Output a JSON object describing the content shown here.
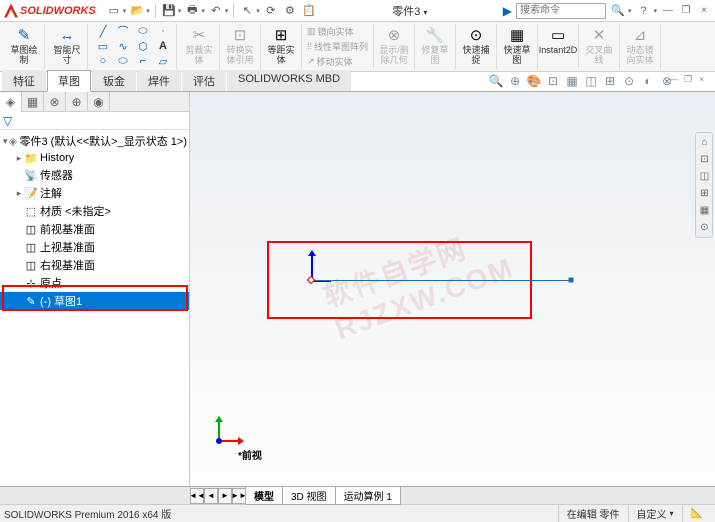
{
  "app": {
    "name": "SOLIDWORKS",
    "doc_title": "零件3"
  },
  "search": {
    "placeholder": "搜索命令",
    "glyph": "🔍",
    "help": "?"
  },
  "window_controls": {
    "min": "—",
    "restore": "❐",
    "close": "×"
  },
  "qat": {
    "new": "▭",
    "open": "📂",
    "save": "💾",
    "print": "🖶",
    "undo": "↶",
    "select": "↖",
    "rebuild": "⟳",
    "options": "⚙",
    "settings": "📋"
  },
  "ribbon": {
    "sketch": {
      "label": "草图绘\n制",
      "icon": "✎"
    },
    "smart_dim": {
      "label": "智能尺\n寸",
      "icon": "↔"
    },
    "tools": {
      "line": "╱",
      "rect": "▭",
      "circle": "○",
      "arc": "⌒",
      "spline": "∿",
      "ellipse": "⬭",
      "slot": "⬭",
      "poly": "⬡",
      "fillet": "⌐",
      "point": "·",
      "text": "A",
      "plane": "▱"
    },
    "groups": [
      {
        "label": "剪裁实\n体",
        "icon": "✂",
        "disabled": true
      },
      {
        "label": "转换实\n体引用",
        "icon": "⊡",
        "disabled": true
      },
      {
        "label": "等距实\n体",
        "icon": "⊞",
        "disabled": false
      },
      {
        "label": "镜向实体",
        "icon": "▥",
        "disabled": true,
        "small": true
      },
      {
        "label": "线性草图阵列",
        "icon": "⁞⁞",
        "disabled": true,
        "small": true
      },
      {
        "label": "移动实体",
        "icon": "↗",
        "disabled": true,
        "small": true
      },
      {
        "label": "显示/删\n除几何",
        "icon": "⊗",
        "disabled": true
      },
      {
        "label": "修复草\n图",
        "icon": "🔧",
        "disabled": true
      },
      {
        "label": "快速捕\n捉",
        "icon": "⊙",
        "disabled": false
      },
      {
        "label": "快速草\n图",
        "icon": "▦",
        "disabled": false
      },
      {
        "label": "Instant2D",
        "icon": "▭",
        "disabled": false
      },
      {
        "label": "交叉曲\n线",
        "icon": "✕",
        "disabled": true
      },
      {
        "label": "动态镜\n向实体",
        "icon": "⊿",
        "disabled": true
      }
    ]
  },
  "tabs": [
    "特征",
    "草图",
    "钣金",
    "焊件",
    "评估",
    "SOLIDWORKS MBD"
  ],
  "active_tab": 1,
  "view_toolbar": [
    "🔍",
    "⊕",
    "🎨",
    "⊡",
    "▦",
    "◫",
    "⊞",
    "⊙",
    "◐",
    "⊗"
  ],
  "sidebar_tabs": [
    "◈",
    "▦",
    "⊗",
    "⊕",
    "◉"
  ],
  "tree": {
    "root": "零件3 (默认<<默认>_显示状态 1>)",
    "nodes": [
      {
        "icon": "📁",
        "label": "History",
        "indent": 1,
        "toggle": "▸"
      },
      {
        "icon": "📡",
        "label": "传感器",
        "indent": 1,
        "toggle": ""
      },
      {
        "icon": "📝",
        "label": "注解",
        "indent": 1,
        "toggle": "▸"
      },
      {
        "icon": "⬚",
        "label": "材质 <未指定>",
        "indent": 1,
        "toggle": ""
      },
      {
        "icon": "◫",
        "label": "前视基准面",
        "indent": 1,
        "toggle": ""
      },
      {
        "icon": "◫",
        "label": "上视基准面",
        "indent": 1,
        "toggle": ""
      },
      {
        "icon": "◫",
        "label": "右视基准面",
        "indent": 1,
        "toggle": ""
      },
      {
        "icon": "⊹",
        "label": "原点",
        "indent": 1,
        "toggle": ""
      },
      {
        "icon": "✎",
        "label": "(-) 草图1",
        "indent": 1,
        "toggle": "",
        "selected": true
      }
    ]
  },
  "viewport": {
    "view_name": "*前视",
    "watermark": "软件自学网\nRJZXW.COM"
  },
  "bottom_tabs": [
    "模型",
    "3D 视图",
    "运动算例 1"
  ],
  "status": {
    "left": "SOLIDWORKS Premium 2016 x64 版",
    "mode": "在编辑 零件",
    "custom": "自定义"
  },
  "right_tools": [
    "⌂",
    "⊡",
    "◫",
    "⊞",
    "▦",
    "⊙"
  ]
}
